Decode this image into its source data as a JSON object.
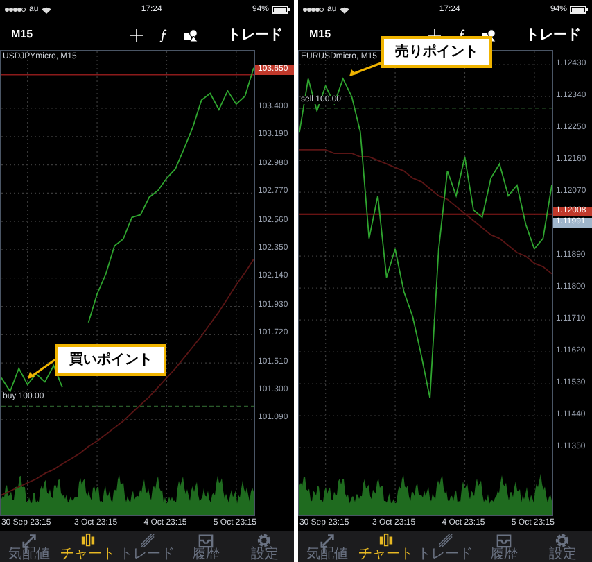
{
  "panels": [
    {
      "status_bar": {
        "carrier": "au",
        "time": "17:24",
        "battery": "94%"
      },
      "toolbar": {
        "timeframe": "M15",
        "trade": "トレード"
      },
      "chart": {
        "order_label": "buy 100.00",
        "price_markers": [
          {
            "text": "103.650",
            "color": "#c0392b"
          }
        ],
        "chart_data": {
          "type": "line",
          "categories": [
            null,
            null,
            null,
            "30 Sep 23:15",
            null,
            null,
            null,
            null,
            null,
            null,
            null,
            "3 Oct 23:15",
            null,
            null,
            null,
            null,
            null,
            null,
            null,
            "4 Oct 23:15",
            null,
            null,
            null,
            null,
            null,
            null,
            null,
            "5 Oct 23:15",
            null,
            null
          ],
          "ylim": [
            100.363,
            103.822
          ],
          "series": [
            {
              "name": "USDJPYmicro, M15",
              "color": "#2fa52f",
              "values": [
                101.4,
                101.3,
                101.47,
                101.35,
                101.43,
                101.37,
                101.49,
                101.33,
                null,
                null,
                101.81,
                102.02,
                102.17,
                102.38,
                102.43,
                102.59,
                102.61,
                102.74,
                102.79,
                102.88,
                102.95,
                103.1,
                103.26,
                103.46,
                103.51,
                103.39,
                103.53,
                103.43,
                103.49,
                103.7
              ]
            },
            {
              "color": "#5a1515",
              "values": [
                100.53,
                100.56,
                100.59,
                100.62,
                100.65,
                100.69,
                100.72,
                100.76,
                100.8,
                100.84,
                100.89,
                100.93,
                100.98,
                101.03,
                101.08,
                101.14,
                101.2,
                101.26,
                101.33,
                101.4,
                101.47,
                101.55,
                101.63,
                101.71,
                101.8,
                101.89,
                101.99,
                102.09,
                102.18,
                102.28
              ]
            }
          ],
          "ref_lines": [
            {
              "axis": "y",
              "value": 103.65,
              "color": "#8b1a1a"
            },
            {
              "axis": "y",
              "value": 101.19,
              "color": "#2a5a2a"
            }
          ],
          "grid": true,
          "yticks": [
            {
              "value": 103.4,
              "label": "103.400"
            },
            {
              "value": 103.19,
              "label": "103.190"
            },
            {
              "value": 102.98,
              "label": "102.980"
            },
            {
              "value": 102.77,
              "label": "102.770"
            },
            {
              "value": 102.56,
              "label": "102.560"
            },
            {
              "value": 102.35,
              "label": "102.350"
            },
            {
              "value": 102.14,
              "label": "102.140"
            },
            {
              "value": 101.93,
              "label": "101.930"
            },
            {
              "value": 101.72,
              "label": "101.720"
            },
            {
              "value": 101.51,
              "label": "101.510"
            },
            {
              "value": 101.3,
              "label": "101.300"
            },
            {
              "value": 101.09,
              "label": "101.090"
            }
          ]
        }
      },
      "callout": "買いポイント",
      "tabs": [
        {
          "label": "気配値",
          "selected": false
        },
        {
          "label": "チャート",
          "selected": true
        },
        {
          "label": "トレード",
          "selected": false
        },
        {
          "label": "履歴",
          "selected": false
        },
        {
          "label": "設定",
          "selected": false
        }
      ]
    },
    {
      "status_bar": {
        "carrier": "au",
        "time": "17:24",
        "battery": "94%"
      },
      "toolbar": {
        "timeframe": "M15",
        "trade": "トレード"
      },
      "chart": {
        "order_label": "sell 100.00",
        "price_markers": [
          {
            "text": "1.12008",
            "color": "#c0392b"
          },
          {
            "text": "1.11991",
            "color": "#9fb6cc"
          }
        ],
        "chart_data": {
          "type": "line",
          "categories": [
            null,
            null,
            null,
            "30 Sep 23:15",
            null,
            null,
            null,
            null,
            null,
            null,
            null,
            "3 Oct 23:15",
            null,
            null,
            null,
            null,
            null,
            null,
            null,
            "4 Oct 23:15",
            null,
            null,
            null,
            null,
            null,
            null,
            null,
            "5 Oct 23:15",
            null,
            null
          ],
          "ylim": [
            1.111525,
            1.124675
          ],
          "series": [
            {
              "name": "EURUSDmicro, M15",
              "color": "#2fa52f",
              "values": [
                1.1224,
                1.1239,
                1.123,
                1.1237,
                1.1232,
                1.1239,
                1.1234,
                1.1224,
                1.1194,
                1.1206,
                1.1183,
                1.1191,
                1.1179,
                1.1172,
                1.1161,
                1.1149,
                1.1191,
                1.1213,
                1.1206,
                1.1217,
                1.1202,
                1.12,
                1.1211,
                1.1215,
                1.1206,
                1.1209,
                1.1198,
                1.1191,
                1.1194,
                1.1209
              ]
            },
            {
              "color": "#5a1515",
              "values": [
                1.1219,
                1.1219,
                1.1219,
                1.1219,
                1.1218,
                1.1218,
                1.1218,
                1.1217,
                1.1217,
                1.1216,
                1.1215,
                1.1214,
                1.1213,
                1.1211,
                1.121,
                1.1208,
                1.1206,
                1.1205,
                1.1203,
                1.1201,
                1.1199,
                1.1197,
                1.1195,
                1.1194,
                1.1192,
                1.119,
                1.1189,
                1.1187,
                1.1186,
                1.1184
              ]
            }
          ],
          "ref_lines": [
            {
              "axis": "y",
              "value": 1.12008,
              "color": "#8b1a1a"
            },
            {
              "axis": "y",
              "value": 1.12307,
              "color": "#2a5a2a"
            }
          ],
          "grid": true,
          "yticks": [
            {
              "value": 1.1243,
              "label": "1.12430"
            },
            {
              "value": 1.1234,
              "label": "1.12340"
            },
            {
              "value": 1.1225,
              "label": "1.12250"
            },
            {
              "value": 1.1216,
              "label": "1.12160"
            },
            {
              "value": 1.1207,
              "label": "1.12070"
            },
            {
              "value": 1.1189,
              "label": "1.11890"
            },
            {
              "value": 1.118,
              "label": "1.11800"
            },
            {
              "value": 1.1171,
              "label": "1.11710"
            },
            {
              "value": 1.1162,
              "label": "1.11620"
            },
            {
              "value": 1.1153,
              "label": "1.11530"
            },
            {
              "value": 1.1144,
              "label": "1.11440"
            },
            {
              "value": 1.1135,
              "label": "1.11350"
            }
          ]
        }
      },
      "callout": "売りポイント",
      "tabs": [
        {
          "label": "気配値",
          "selected": false
        },
        {
          "label": "チャート",
          "selected": true
        },
        {
          "label": "トレード",
          "selected": false
        },
        {
          "label": "履歴",
          "selected": false
        },
        {
          "label": "設定",
          "selected": false
        }
      ]
    }
  ]
}
